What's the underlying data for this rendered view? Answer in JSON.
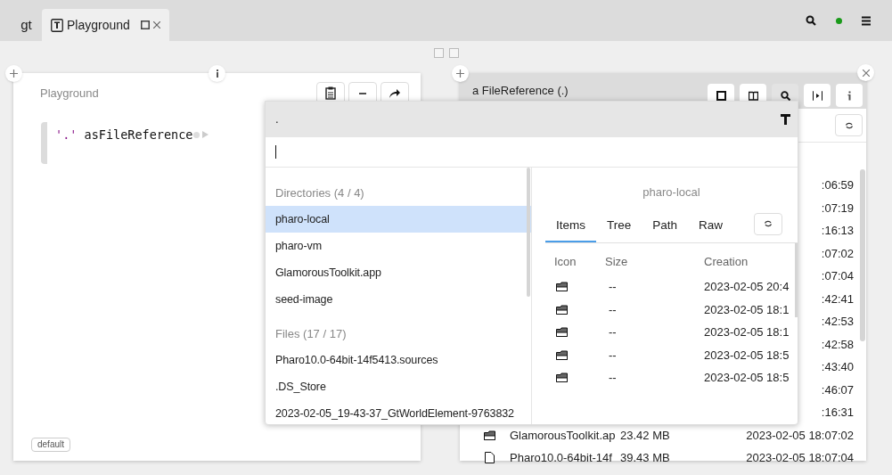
{
  "top_bar": {
    "logo": "gt",
    "tabs": [
      {
        "label": "Playground",
        "selected": true
      }
    ]
  },
  "playground": {
    "title": "Playground",
    "code": [
      {
        "kind": "string",
        "text": "'.'"
      },
      {
        "kind": "selector",
        "text": "asFileReference"
      }
    ],
    "badge": "default"
  },
  "inspector": {
    "title": "a FileReference (.)",
    "view_buttons": [
      {
        "kind": "square",
        "selected": false
      },
      {
        "kind": "book",
        "selected": false
      },
      {
        "kind": "search",
        "selected": true
      },
      {
        "kind": "play",
        "selected": false
      },
      {
        "kind": "info",
        "selected": false
      }
    ],
    "rows": [
      {
        "creation": ":06:59"
      },
      {
        "creation": ":07:19"
      },
      {
        "creation": ":16:13"
      },
      {
        "creation": ":07:02"
      },
      {
        "creation": ":07:04"
      },
      {
        "creation": ":42:41"
      },
      {
        "creation": ":42:53"
      },
      {
        "creation": ":42:58"
      },
      {
        "creation": ":43:40"
      },
      {
        "creation": ":46:07"
      },
      {
        "creation": ":16:31"
      },
      {
        "kind": "directory",
        "name": "GlamorousToolkit.ap",
        "size": "23.42 MB",
        "creation": "2023-02-05 18:07:02"
      },
      {
        "kind": "file",
        "name": "Pharo10.0-64bit-14f",
        "size": "39.43 MB",
        "creation": "2023-02-05 18:07:04"
      }
    ]
  },
  "spotter": {
    "query": ".",
    "sections": [
      {
        "title": "Directories (4 / 4)",
        "items": [
          {
            "label": "pharo-local",
            "selected": true
          },
          {
            "label": "pharo-vm",
            "selected": false
          },
          {
            "label": "GlamorousToolkit.app",
            "selected": false
          },
          {
            "label": "seed-image",
            "selected": false
          }
        ]
      },
      {
        "title": "Files (17 / 17)",
        "items": [
          {
            "label": "Pharo10.0-64bit-14f5413.sources",
            "selected": false
          },
          {
            "label": ".DS_Store",
            "selected": false
          },
          {
            "label": "2023-02-05_19-43-37_GtWorldElement-9763832",
            "selected": false
          }
        ]
      }
    ],
    "preview": {
      "title": "pharo-local",
      "tabs": [
        {
          "label": "Items",
          "selected": true
        },
        {
          "label": "Tree",
          "selected": false
        },
        {
          "label": "Path",
          "selected": false
        },
        {
          "label": "Raw",
          "selected": false
        }
      ],
      "columns": [
        "Icon",
        "Size",
        "Creation"
      ],
      "rows": [
        {
          "kind": "directory",
          "size": "--",
          "creation": "2023-02-05 20:4"
        },
        {
          "kind": "directory",
          "size": "--",
          "creation": "2023-02-05 18:1"
        },
        {
          "kind": "directory",
          "size": "--",
          "creation": "2023-02-05 18:1"
        },
        {
          "kind": "directory",
          "size": "--",
          "creation": "2023-02-05 18:5"
        },
        {
          "kind": "directory",
          "size": "--",
          "creation": "2023-02-05 18:5"
        }
      ]
    }
  }
}
